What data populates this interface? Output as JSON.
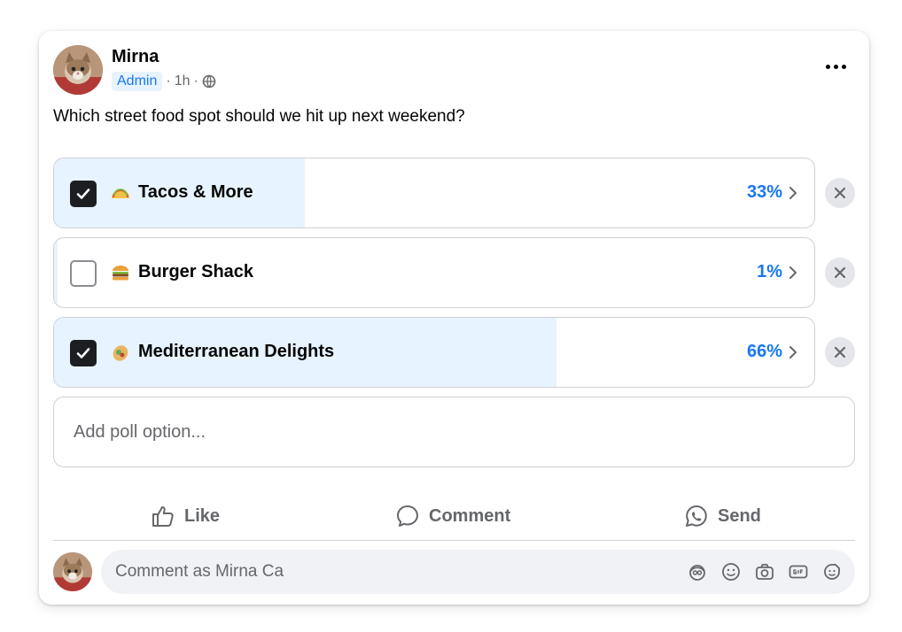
{
  "post": {
    "author": "Mirna",
    "role": "Admin",
    "meta_separator_1": "·",
    "time": "1h",
    "meta_separator_2": "·",
    "audience_icon": "globe-icon",
    "question": "Which street food spot should we hit up next weekend?"
  },
  "poll": {
    "options": [
      {
        "label": "Tacos & More",
        "percent_text": "33%",
        "percent": 33,
        "checked": true,
        "emoji_icon": "taco-icon"
      },
      {
        "label": "Burger Shack",
        "percent_text": "1%",
        "percent": 1,
        "checked": false,
        "emoji_icon": "burger-icon"
      },
      {
        "label": "Mediterranean Delights",
        "percent_text": "66%",
        "percent": 66,
        "checked": true,
        "emoji_icon": "falafel-icon"
      }
    ],
    "add_option_placeholder": "Add poll option..."
  },
  "actions": {
    "like": "Like",
    "comment": "Comment",
    "send": "Send"
  },
  "comment_bar": {
    "placeholder": "Comment as Mirna Ca",
    "tools": [
      "avatar-sticker-icon",
      "emoji-icon",
      "camera-icon",
      "gif-icon",
      "sticker-icon"
    ]
  },
  "colors": {
    "accent": "#1877f2",
    "fill": "#e7f3ff",
    "secondary_text": "#65676b",
    "border": "#ced0d4"
  }
}
